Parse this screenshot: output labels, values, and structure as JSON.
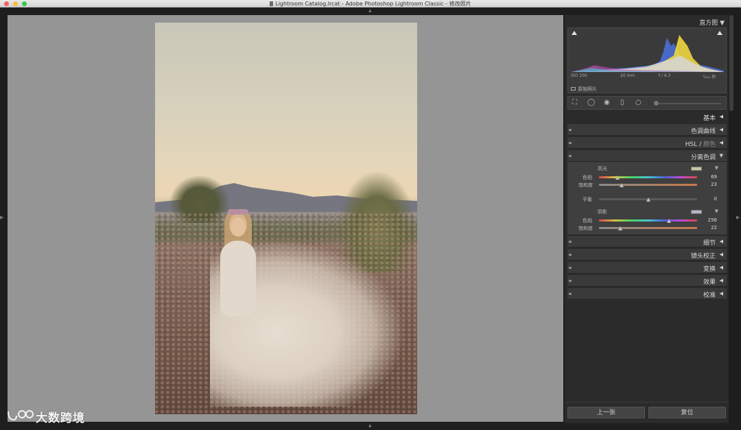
{
  "window": {
    "title": "Lightroom Catalog.lrcat - Adobe Photoshop Lightroom Classic - 修改照片"
  },
  "histogram": {
    "title": "直方图",
    "iso": "ISO 100",
    "focal": "20 mm",
    "aperture": "f / 6.3",
    "shutter": "¹/₂₅₀ 秒",
    "original_label": "原始照片"
  },
  "sections": {
    "basic": "基本",
    "tone_curve": "色调曲线",
    "hsl": "HSL",
    "hsl_sep": " / ",
    "color": "颜色",
    "split_toning": "分离色调",
    "detail": "细节",
    "lens": "镜头校正",
    "transform": "变换",
    "effects": "效果",
    "calibration": "校准"
  },
  "split_toning": {
    "highlights_label": "高光",
    "highlights_hue_label": "色相",
    "highlights_hue": "69",
    "highlights_hue_fraction": 0.19,
    "highlights_sat_label": "饱和度",
    "highlights_sat": "23",
    "highlights_sat_fraction": 0.23,
    "balance_label": "平衡",
    "balance": "0",
    "balance_fraction": 0.5,
    "shadows_label": "阴影",
    "shadows_hue_label": "色相",
    "shadows_hue": "256",
    "shadows_hue_fraction": 0.71,
    "shadows_sat_label": "饱和度",
    "shadows_sat": "22",
    "shadows_sat_fraction": 0.22,
    "highlight_swatch": "#c8c5a0",
    "shadow_swatch": "#b8b2cc"
  },
  "footer": {
    "prev": "上一张",
    "reset": "复位"
  },
  "watermark": {
    "text": "大数跨境"
  }
}
